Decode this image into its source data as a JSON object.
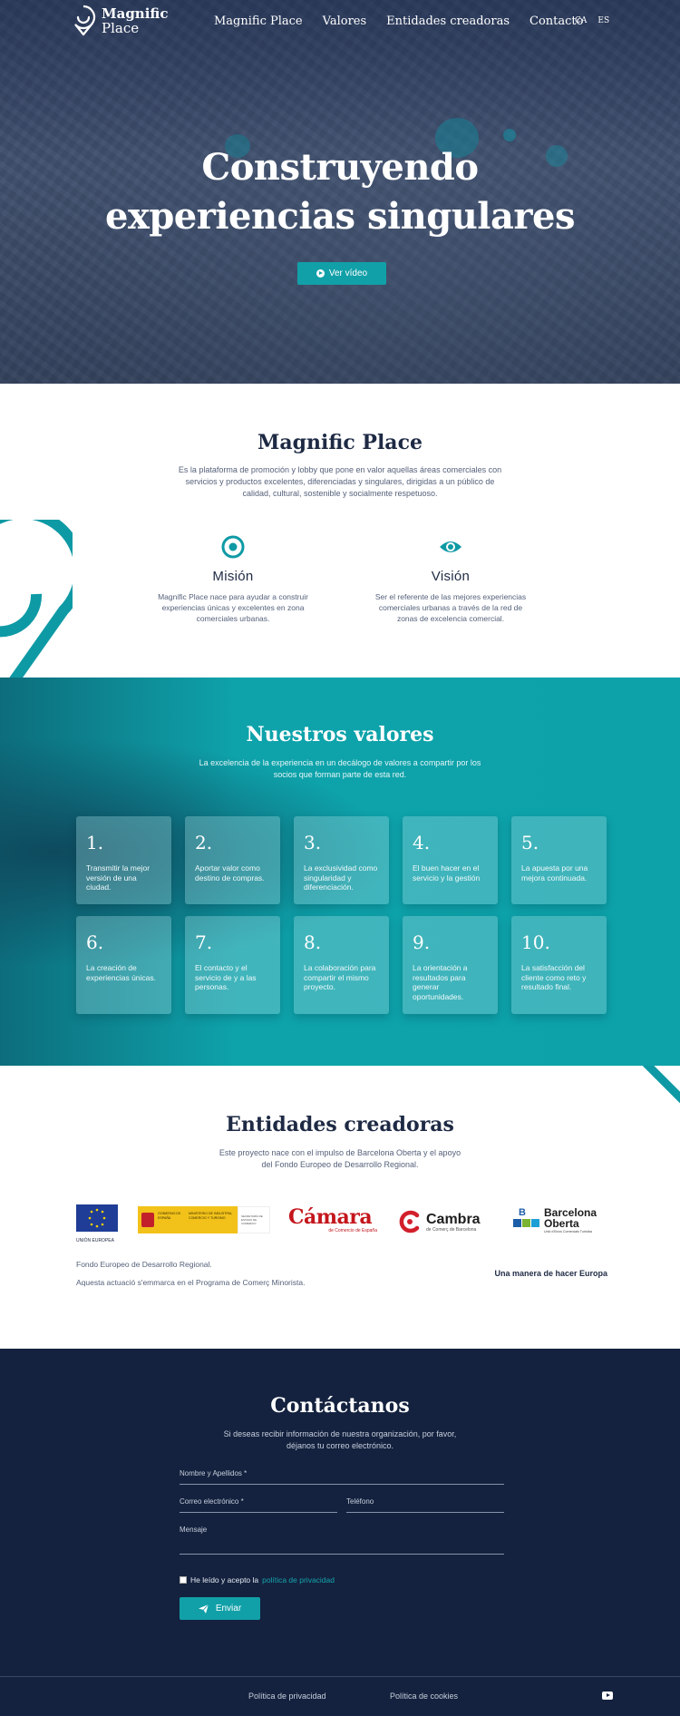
{
  "header": {
    "logo_line1": "Magnific",
    "logo_line2": "Place",
    "nav": [
      "Magnific Place",
      "Valores",
      "Entidades creadoras",
      "Contacto"
    ],
    "langs": [
      "CA",
      "ES"
    ]
  },
  "hero": {
    "title_line1": "Construyendo",
    "title_line2": "experiencias singulares",
    "video_button": "Ver vídeo"
  },
  "about": {
    "title": "Magnific Place",
    "text": "Es la plataforma de promoción y lobby que pone en valor aquellas áreas comerciales con servicios y productos excelentes, diferenciadas y singulares, dirigidas a un público de calidad, cultural, sostenible y socialmente respetuoso.",
    "mission": {
      "icon": "target-icon",
      "title": "Misión",
      "text": "Magnific Place nace para ayudar a construir experiencias únicas y excelentes en zona comerciales urbanas."
    },
    "vision": {
      "icon": "eye-icon",
      "title": "Visión",
      "text": "Ser el referente de las mejores experiencias comerciales urbanas a través de la red de zonas de excelencia comercial."
    }
  },
  "values": {
    "title": "Nuestros valores",
    "subtitle": "La excelencia de la experiencia en un decálogo de valores a compartir por los socios que forman parte de esta red.",
    "items": [
      {
        "num": "1.",
        "text": "Transmitir la mejor versión de una ciudad."
      },
      {
        "num": "2.",
        "text": "Aportar valor como destino de compras."
      },
      {
        "num": "3.",
        "text": "La exclusividad como singularidad y diferenciación."
      },
      {
        "num": "4.",
        "text": "El buen hacer en el servicio y la gestión"
      },
      {
        "num": "5.",
        "text": "La apuesta por una mejora continuada."
      },
      {
        "num": "6.",
        "text": "La creación de experiencias únicas."
      },
      {
        "num": "7.",
        "text": "El contacto y el servicio de y a las personas."
      },
      {
        "num": "8.",
        "text": "La colaboración para compartir el mismo proyecto."
      },
      {
        "num": "9.",
        "text": "La orientación a resultados para generar oportunidades."
      },
      {
        "num": "10.",
        "text": "La satisfacción del cliente como reto y resultado final."
      }
    ]
  },
  "entities": {
    "title": "Entidades creadoras",
    "subtitle": "Este proyecto nace con el impulso de Barcelona Oberta y el apoyo del Fondo Europeo de Desarrollo Regional.",
    "logos": {
      "eu": "UNIÓN EUROPEA",
      "gob_left": "GOBIERNO DE ESPAÑA",
      "gob_right": "MINISTERIO DE INDUSTRIA, COMERCIO Y TURISMO",
      "gob_extra": "SECRETARÍA DE ESTADO DE COMERCIO",
      "camara": "Cámara",
      "camara_sub": "de Comercio de España",
      "cambra": "Cambra",
      "cambra_sub": "de Comerç de Barcelona",
      "bo_line1": "Barcelona",
      "bo_line2": "Oberta",
      "bo_sub": "Unió d'Eixos Comercials Turístics"
    },
    "note1": "Fondo Europeo de Desarrollo Regional.",
    "note2": "Aquesta actuació s'emmarca en el Programa de Comerç Minorista.",
    "motto": "Una manera de hacer Europa"
  },
  "contact": {
    "title": "Contáctanos",
    "subtitle": "Si deseas recibir información de nuestra organización, por favor, déjanos tu correo electrónico.",
    "name_label": "Nombre y Apellidos *",
    "email_label": "Correo electrónico *",
    "phone_label": "Teléfono",
    "message_label": "Mensaje",
    "consent_text": "He leído y acepto la",
    "consent_link": "política de privacidad",
    "send_button": "Enviar"
  },
  "footer": {
    "privacy": "Política de privacidad",
    "cookies": "Política de cookies"
  },
  "colors": {
    "accent": "#11a0a8",
    "navy": "#14223f",
    "heading": "#1e2a44"
  }
}
